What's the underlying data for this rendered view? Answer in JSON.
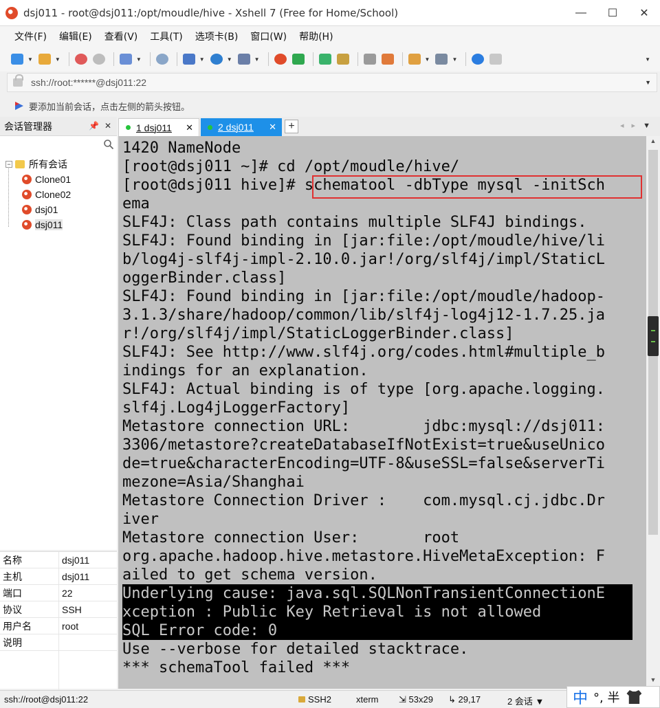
{
  "window": {
    "title": "dsj011 - root@dsj011:/opt/moudle/hive - Xshell 7 (Free for Home/School)",
    "minimize_glyph": "—",
    "maximize_glyph": "☐",
    "close_glyph": "✕"
  },
  "menu": [
    "文件(F)",
    "编辑(E)",
    "查看(V)",
    "工具(T)",
    "选项卡(B)",
    "窗口(W)",
    "帮助(H)"
  ],
  "address": {
    "value": "ssh://root:******@dsj011:22"
  },
  "hint": {
    "text": "要添加当前会话，点击左侧的箭头按钮。"
  },
  "session_manager": {
    "title": "会话管理器",
    "root": "所有会话",
    "sessions": [
      "Clone01",
      "Clone02",
      "dsj01",
      "dsj011"
    ],
    "selected": "dsj011"
  },
  "properties": [
    {
      "key": "名称",
      "value": "dsj011"
    },
    {
      "key": "主机",
      "value": "dsj011"
    },
    {
      "key": "端口",
      "value": "22"
    },
    {
      "key": "协议",
      "value": "SSH"
    },
    {
      "key": "用户名",
      "value": "root"
    },
    {
      "key": "说明",
      "value": ""
    }
  ],
  "tabs": [
    {
      "num": "1",
      "label": "1 dsj011",
      "active": false
    },
    {
      "num": "2",
      "label": "2 dsj011",
      "active": true
    }
  ],
  "tab_add": "+",
  "terminal": {
    "lines": [
      "1420 NameNode",
      "[root@dsj011 ~]# cd /opt/moudle/hive/",
      "[root@dsj011 hive]# schematool -dbType mysql -initSch",
      "ema",
      "SLF4J: Class path contains multiple SLF4J bindings.",
      "SLF4J: Found binding in [jar:file:/opt/moudle/hive/li",
      "b/log4j-slf4j-impl-2.10.0.jar!/org/slf4j/impl/StaticL",
      "oggerBinder.class]",
      "SLF4J: Found binding in [jar:file:/opt/moudle/hadoop-",
      "3.1.3/share/hadoop/common/lib/slf4j-log4j12-1.7.25.ja",
      "r!/org/slf4j/impl/StaticLoggerBinder.class]",
      "SLF4J: See http://www.slf4j.org/codes.html#multiple_b",
      "indings for an explanation.",
      "SLF4J: Actual binding is of type [org.apache.logging.",
      "slf4j.Log4jLoggerFactory]",
      "Metastore connection URL:        jdbc:mysql://dsj011:",
      "3306/metastore?createDatabaseIfNotExist=true&useUnico",
      "de=true&characterEncoding=UTF-8&useSSL=false&serverTi",
      "mezone=Asia/Shanghai",
      "Metastore Connection Driver :    com.mysql.cj.jdbc.Dr",
      "iver",
      "Metastore connection User:       root",
      "org.apache.hadoop.hive.metastore.HiveMetaException: F",
      "ailed to get schema version.",
      "Underlying cause: java.sql.SQLNonTransientConnectionE",
      "xception : Public Key Retrieval is not allowed",
      "SQL Error code: 0",
      "Use --verbose for detailed stacktrace.",
      "*** schemaTool failed ***"
    ],
    "highlighted_lines": [
      24,
      25,
      26
    ],
    "boxed_command": "schematool -dbType mysql -initSch"
  },
  "status": {
    "address": "ssh://root@dsj011:22",
    "protocol": "SSH2",
    "term": "xterm",
    "size": "53x29",
    "cursor": "29,17",
    "sessions": "2 会话"
  },
  "ime": {
    "mode": "中",
    "punct": "°, 半"
  },
  "colors": {
    "tab_active": "#1e90e8",
    "terminal_bg": "#c0c0c0",
    "highlight_box": "#e03030",
    "connected_dot": "#26c43c"
  }
}
